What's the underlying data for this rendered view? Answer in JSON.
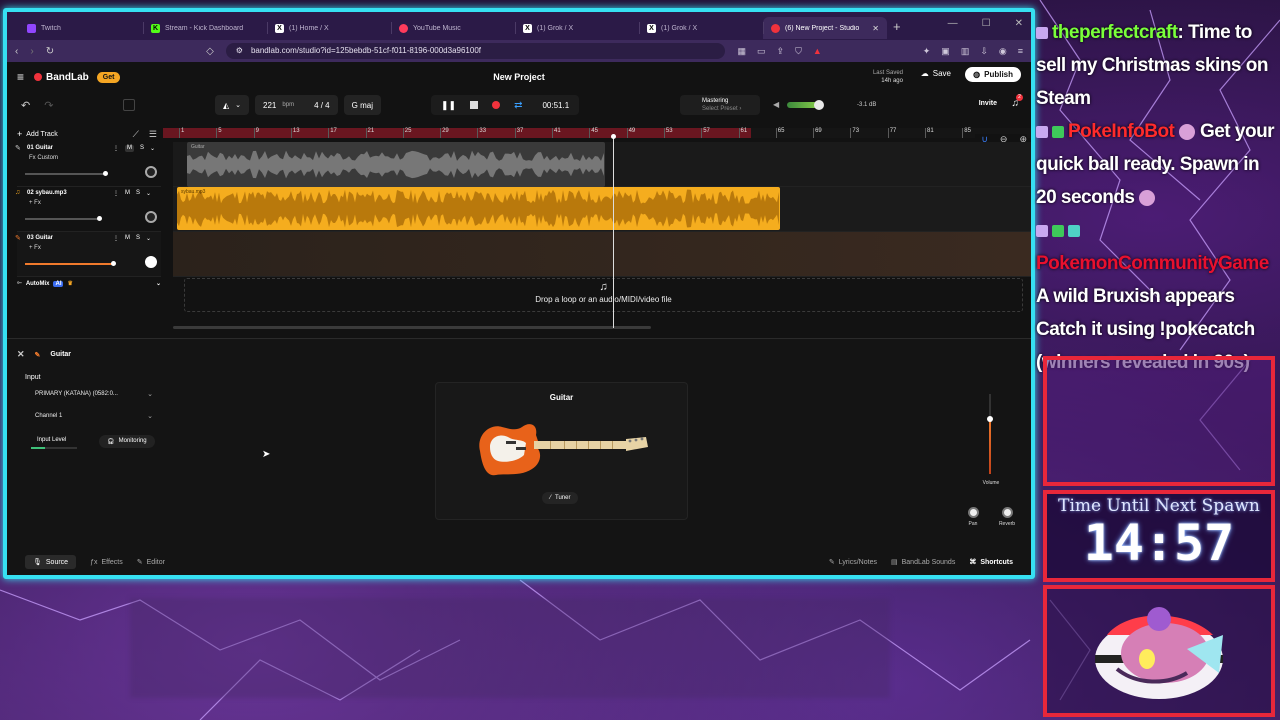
{
  "browser": {
    "tabs": [
      {
        "label": "Twitch",
        "color": "#9146ff",
        "glyph": "t"
      },
      {
        "label": "Stream - Kick Dashboard",
        "color": "#53fc18",
        "glyph": "K"
      },
      {
        "label": "(1) Home / X",
        "color": "#ffffff",
        "glyph": "X"
      },
      {
        "label": "YouTube Music",
        "color": "#ff3b5c",
        "glyph": "▶"
      },
      {
        "label": "(1) Grok / X",
        "color": "#ffffff",
        "glyph": "X"
      },
      {
        "label": "(1) Grok / X",
        "color": "#ffffff",
        "glyph": "X"
      },
      {
        "label": "(6) New Project - Studio",
        "color": "#f0323c",
        "glyph": "b",
        "active": true
      }
    ],
    "url": "bandlab.com/studio?id=125bebdb-51cf-f011-8196-000d3a96100f"
  },
  "app": {
    "brand": "BandLab",
    "get_label": "Get",
    "project_title": "New Project",
    "last_saved_label": "Last Saved",
    "last_saved_value": "14h ago",
    "save_label": "Save",
    "publish_label": "Publish",
    "tempo": "221",
    "tempo_unit": "bpm",
    "time_sig": "4 / 4",
    "key": "G maj",
    "time": "00:51.1",
    "mastering_label": "Mastering",
    "mastering_preset": "Select Preset ›",
    "master_db": "-3.1 dB",
    "invite_label": "Invite",
    "notif_count": "2",
    "add_track_label": "Add Track",
    "ruler_ticks": [
      "1",
      "5",
      "9",
      "13",
      "17",
      "21",
      "25",
      "29",
      "33",
      "37",
      "41",
      "45",
      "49",
      "53",
      "57",
      "61",
      "65",
      "69",
      "73",
      "77",
      "81",
      "85"
    ],
    "tracks": [
      {
        "name": "01  Guitar",
        "fx": "Fx Custom",
        "clip": "Guitar"
      },
      {
        "name": "02  sybau.mp3",
        "fx": "+ Fx",
        "clip": "sybau.mp3"
      },
      {
        "name": "03  Guitar",
        "fx": "+ Fx",
        "clip": ""
      }
    ],
    "automix_label": "AutoMix",
    "automix_ai": "AI",
    "drop_text": "Drop a loop or an audio/MIDI/video file",
    "panel": {
      "title": "Guitar",
      "input_label": "Input",
      "input_device": "PRIMARY (KATANA) (0582:0...",
      "channel": "Channel 1",
      "input_level_label": "Input Level",
      "monitoring_label": "Monitoring",
      "instrument_title": "Guitar",
      "tuner_label": "Tuner",
      "volume_label": "Volume",
      "pan_label": "Pan",
      "reverb_label": "Reverb"
    },
    "footer": {
      "source": "Source",
      "effects": "Effects",
      "editor": "Editor",
      "lyrics": "Lyrics/Notes",
      "sounds": "BandLab Sounds",
      "shortcuts": "Shortcuts"
    }
  },
  "overlay": {
    "chat": [
      {
        "user": "theperfectcraft",
        "text": ": Time to sell my Christmas skins on Steam"
      },
      {
        "user": "PokeInfoBot",
        "text": "Get your quick ball ready. Spawn in 20 seconds"
      },
      {
        "user": "PokemonCommunityGame",
        "text": "A wild Bruxish appears  Catch it using !pokecatch (winners revealed in 90s)"
      }
    ],
    "timer_label": "Time Until Next Spawn",
    "timer_value": "14:57"
  }
}
